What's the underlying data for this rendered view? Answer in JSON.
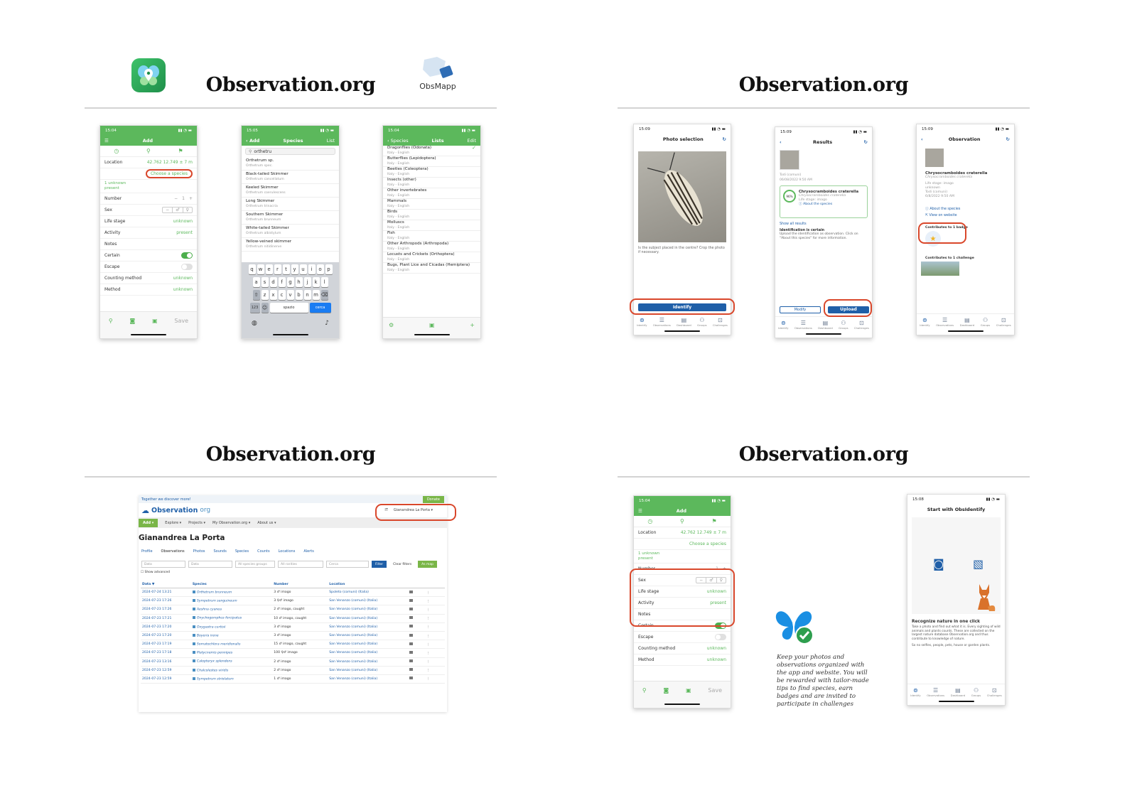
{
  "titles": {
    "q1": "Observation.org",
    "q2": "Observation.org",
    "q3": "Observation.org",
    "q4": "Observation.org"
  },
  "logos": {
    "obsmapp_label": "ObsMapp",
    "app_icon": "obsidentify-app-icon"
  },
  "add_screen": {
    "time": "15:04",
    "title": "Add",
    "location_label": "Location",
    "location_value": "42.762 12.749 ± 7 m",
    "choose_species": "Choose a species",
    "unknown_line1": "1 unknown",
    "unknown_line2": "present",
    "number_label": "Number",
    "number_value": "1",
    "sex_label": "Sex",
    "life_stage_label": "Life stage",
    "life_stage_value": "unknown",
    "activity_label": "Activity",
    "activity_value": "present",
    "notes_label": "Notes",
    "certain_label": "Certain",
    "escape_label": "Escape",
    "counting_label": "Counting method",
    "counting_value": "unknown",
    "method_label": "Method",
    "method_value": "unknown",
    "save_label": "Save"
  },
  "species_screen": {
    "time": "15:05",
    "back": "Add",
    "title": "Species",
    "list_button": "List",
    "search_value": "orthetru",
    "items": [
      {
        "name": "Orthetrum sp.",
        "sci": "Orthetrum spec."
      },
      {
        "name": "Black-tailed Skimmer",
        "sci": "Orthetrum cancellatum"
      },
      {
        "name": "Keeled Skimmer",
        "sci": "Orthetrum coerulescens"
      },
      {
        "name": "Long Skimmer",
        "sci": "Orthetrum trinacria"
      },
      {
        "name": "Southern Skimmer",
        "sci": "Orthetrum brunneum"
      },
      {
        "name": "White-tailed Skimmer",
        "sci": "Orthetrum albistylum"
      },
      {
        "name": "Yellow-veined skimmer",
        "sci": "Orthetrum nitidinerve"
      }
    ],
    "kb_row1": [
      "q",
      "w",
      "e",
      "r",
      "t",
      "y",
      "u",
      "i",
      "o",
      "p"
    ],
    "kb_row2": [
      "a",
      "s",
      "d",
      "f",
      "g",
      "h",
      "j",
      "k",
      "l"
    ],
    "kb_row3": [
      "z",
      "x",
      "c",
      "v",
      "b",
      "n",
      "m"
    ],
    "kb_123": "123",
    "kb_space": "spazio",
    "kb_search": "cerca"
  },
  "lists_screen": {
    "time": "15:04",
    "back": "Species",
    "title": "Lists",
    "edit": "Edit",
    "items": [
      {
        "name": "Dragonflies (Odonata)",
        "sub": "Italy - English"
      },
      {
        "name": "Butterflies (Lepidoptera)",
        "sub": "Italy - English"
      },
      {
        "name": "Beetles (Coleoptera)",
        "sub": "Italy - English"
      },
      {
        "name": "Insects (other)",
        "sub": "Italy - English"
      },
      {
        "name": "Other invertebrates",
        "sub": "Italy - English"
      },
      {
        "name": "Mammals",
        "sub": "Italy - English"
      },
      {
        "name": "Birds",
        "sub": "Italy - English"
      },
      {
        "name": "Molluscs",
        "sub": "Italy - English"
      },
      {
        "name": "Fish",
        "sub": "Italy - English"
      },
      {
        "name": "Other Arthropods (Arthropoda)",
        "sub": "Italy - English"
      },
      {
        "name": "Locusts and Crickets (Orthoptera)",
        "sub": "Italy - English"
      },
      {
        "name": "Bugs, Plant Lice and Cicadas (Hemiptera)",
        "sub": "Italy - English"
      }
    ]
  },
  "photo_screen": {
    "time": "15:09",
    "title": "Photo selection",
    "hint": "Is the subject placed in the centre? Crop the photo if necessary.",
    "identify": "Identify"
  },
  "results_screen": {
    "time": "15:09",
    "title": "Results",
    "meta1": "Todi (comuni)",
    "meta2": "06/08/2022 9:50 AM",
    "pct": "96%",
    "species": "Chrysocramboides craterella",
    "species_sci": "Chrysocramboides craterella",
    "stage": "Life stage: imago",
    "about": "About the species",
    "show_all": "Show all results",
    "certain_title": "Identification is certain",
    "certain_text": "Upload the identification as observation. Click on \"About this species\" for more information.",
    "modify": "Modify",
    "upload": "Upload"
  },
  "observation_screen": {
    "time": "15:09",
    "title": "Observation",
    "species": "Chrysocramboides craterella",
    "sci": "Chrysocramboides craterella",
    "stage": "Life stage: imago",
    "unknown": "unknown",
    "place": "Todi (comuni)",
    "date": "6/8/2022 9:50 AM",
    "about": "About the species",
    "website": "View on website",
    "badges": "Contributes to 1 badge",
    "challenge": "Contributes to 1 challenge"
  },
  "tabbar": {
    "tabs": [
      "Identify",
      "Observations",
      "Dashboard",
      "Groups",
      "Challenges"
    ]
  },
  "website": {
    "top_text": "Together we discover more!",
    "donate": "Donate",
    "logo": "Observation",
    "logo_suffix": "org",
    "lang": "IT",
    "user_menu": "Gianandrea La Porta",
    "menu": [
      "Add",
      "Explore",
      "Projects",
      "My Observation.org",
      "About us"
    ],
    "heading": "Gianandrea La Porta",
    "tabs": [
      "Profile",
      "Observations",
      "Photos",
      "Sounds",
      "Species",
      "Counts",
      "Locations",
      "Alerts"
    ],
    "filter_date1": "Data",
    "filter_date2": "Data",
    "filter_groups": "All species groups",
    "filter_rarities": "All rarities",
    "filter_search": "Cerca",
    "filter_btn": "Filter",
    "clear_btn": "Clear filters",
    "map_btn": "As map",
    "show_advanced": "Show advanced",
    "columns": [
      "Data",
      "Species",
      "Number",
      "Location"
    ],
    "rows": [
      {
        "date": "2024-07-24 13:21",
        "species": "Orthetrum brunneum",
        "number": "3 ♂ imago",
        "location": "Spoleto (comuni) (Italia)"
      },
      {
        "date": "2024-07-23 17:26",
        "species": "Sympetrum sanguineum",
        "number": "3 ♀♂ imago",
        "location": "San Venanzo (comuni) (Italia)"
      },
      {
        "date": "2024-07-23 17:26",
        "species": "Aeshna cyanea",
        "number": "2 ♂ imago, caught",
        "location": "San Venanzo (comuni) (Italia)"
      },
      {
        "date": "2024-07-23 17:21",
        "species": "Onychogomphus forcipatus",
        "number": "10 ♂ imago, caught",
        "location": "San Venanzo (comuni) (Italia)"
      },
      {
        "date": "2024-07-23 17:20",
        "species": "Oxygastra curtisii",
        "number": "3 ♂ imago",
        "location": "San Venanzo (comuni) (Italia)"
      },
      {
        "date": "2024-07-23 17:20",
        "species": "Boyeria irene",
        "number": "3 ♂ imago",
        "location": "San Venanzo (comuni) (Italia)"
      },
      {
        "date": "2024-07-23 17:19",
        "species": "Somatochlora meridionalis",
        "number": "15 ♂ imago, caught",
        "location": "San Venanzo (comuni) (Italia)"
      },
      {
        "date": "2024-07-23 17:18",
        "species": "Platycnemis pennipes",
        "number": "100 ♀♂ imago",
        "location": "San Venanzo (comuni) (Italia)"
      },
      {
        "date": "2024-07-23 13:16",
        "species": "Calopteryx splendens",
        "number": "2 ♂ imago",
        "location": "San Venanzo (comuni) (Italia)"
      },
      {
        "date": "2024-07-23 12:59",
        "species": "Chalcolestes viridis",
        "number": "2 ♂ imago",
        "location": "San Venanzo (comuni) (Italia)"
      },
      {
        "date": "2024-07-23 12:59",
        "species": "Sympetrum striolatum",
        "number": "1 ♂ imago",
        "location": "San Venanzo (comuni) (Italia)"
      }
    ]
  },
  "start_screen": {
    "time": "15:08",
    "title": "Start with ObsIdentify",
    "recognize": "Recognize nature in one click",
    "text1": "Take a photo and find out what it is. Every sighting of wild animals and plants counts. These are collected on the largest nature database Observation.org and thus contribute to knowledge of nature.",
    "text2": "So no selfies, people, pets, house or garden plants."
  },
  "caption": "Keep your photos and observations organized with the app and website. You will be rewarded with tailor-made tips to find species, earn badges and are invited to participate in challenges",
  "colors": {
    "green": "#5cb85c",
    "red_highlight": "#d9472b",
    "blue": "#1f5fa8"
  }
}
